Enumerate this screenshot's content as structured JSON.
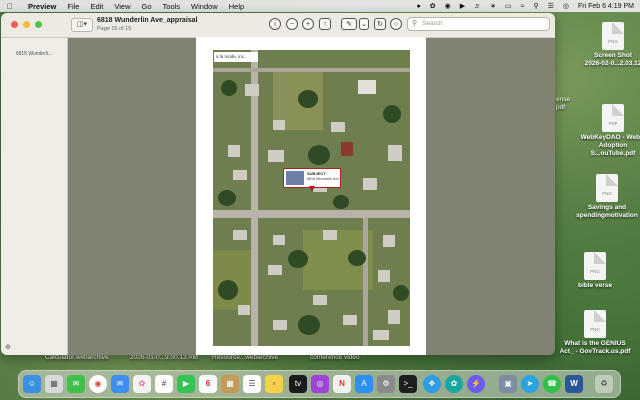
{
  "menubar": {
    "app_name": "Preview",
    "menus": [
      "File",
      "Edit",
      "View",
      "Go",
      "Tools",
      "Window",
      "Help"
    ],
    "clock": "Fri Feb 6  4:19 PM"
  },
  "window": {
    "doc_title": "6818 Wunderlin Ave_appraisal",
    "page_indicator": "Page 15 of 15",
    "search_placeholder": "Search",
    "sidebar_thumb_label": "6818 Wunderli...",
    "map_header": "a la mode, inc.",
    "subject_label": "SUBJECT",
    "subject_address": "6818 Wunderlin Ave"
  },
  "desktop": {
    "icons": [
      {
        "name": "Screen Shot",
        "label_line1": "Screen Shot",
        "label_line2": "2026-02-0...2.03.12",
        "type": "PNG"
      },
      {
        "name": "WebKeyDAO",
        "label_line1": "WebKeyDAO - Web 3",
        "label_line2": "Adoption S...ouTube.pdf",
        "type": "PDF"
      },
      {
        "name": "Savings",
        "label_line1": "Savings and",
        "label_line2": "spendingmotivation",
        "type": "PNG"
      },
      {
        "name": "bible verse",
        "label_line1": "bible verse",
        "label_line2": "",
        "type": "PNG"
      },
      {
        "name": "GENIUS",
        "label_line1": "What is the GENIUS",
        "label_line2": "Act_ - GovTrack.us.pdf",
        "type": "PNG"
      }
    ],
    "partial_labels": [
      "ense",
      "pdf"
    ],
    "bottom_labels": [
      "Calculator.webarchive",
      "2026-01-0...9.00.13 AM",
      "Resource...webarchive",
      "conference video"
    ]
  },
  "dock": {
    "apps": [
      "Finder",
      "Launchpad",
      "Messages",
      "Chrome",
      "Mail",
      "Photos",
      "Slack",
      "FaceTime",
      "Calendar",
      "Notes",
      "Reminders",
      "Stickies",
      "Apple TV",
      "Podcasts",
      "News",
      "App Store",
      "System Settings",
      "Terminal",
      "Safari",
      "ChatGPT",
      "Messenger",
      "Preview",
      "Telegram",
      "WhatsApp",
      "Word",
      "Trash"
    ],
    "calendar_day": "6"
  },
  "colors": {
    "close": "#ee5e55",
    "minimize": "#f5bd3b",
    "zoom": "#5bc248"
  }
}
